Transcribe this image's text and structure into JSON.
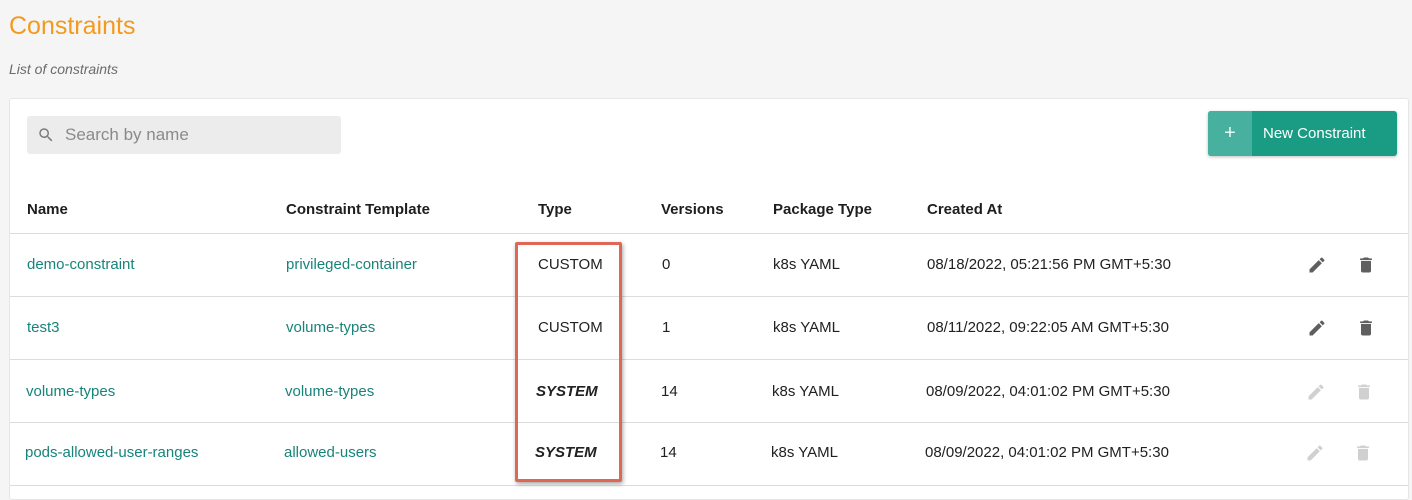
{
  "header": {
    "title": "Constraints",
    "subtitle": "List of constraints"
  },
  "toolbar": {
    "search_placeholder": "Search by name",
    "new_button_icon": "+",
    "new_button_label": "New Constraint"
  },
  "table": {
    "columns": [
      "Name",
      "Constraint Template",
      "Type",
      "Versions",
      "Package Type",
      "Created At"
    ],
    "rows": [
      {
        "name": "demo-constraint",
        "template": "privileged-container",
        "type": "CUSTOM",
        "versions": "0",
        "package_type": "k8s YAML",
        "created_at": "08/18/2022, 05:21:56 PM GMT+5:30",
        "actions_enabled": true
      },
      {
        "name": "test3",
        "template": "volume-types",
        "type": "CUSTOM",
        "versions": "1",
        "package_type": "k8s YAML",
        "created_at": "08/11/2022, 09:22:05 AM GMT+5:30",
        "actions_enabled": true
      },
      {
        "name": "volume-types",
        "template": "volume-types",
        "type": "SYSTEM",
        "versions": "14",
        "package_type": "k8s YAML",
        "created_at": "08/09/2022, 04:01:02 PM GMT+5:30",
        "actions_enabled": false
      },
      {
        "name": "pods-allowed-user-ranges",
        "template": "allowed-users",
        "type": "SYSTEM",
        "versions": "14",
        "package_type": "k8s YAML",
        "created_at": "08/09/2022, 04:01:02 PM GMT+5:30",
        "actions_enabled": false
      }
    ]
  },
  "icons": {
    "search": "search-icon",
    "edit": "pencil-icon",
    "delete": "trash-icon"
  },
  "colors": {
    "title": "#f39a1e",
    "link": "#17847a",
    "primary_button": "#1a9b84",
    "highlight_border": "#e06656",
    "icon_enabled": "#6b6b6b",
    "icon_disabled": "#cfcfcf"
  }
}
